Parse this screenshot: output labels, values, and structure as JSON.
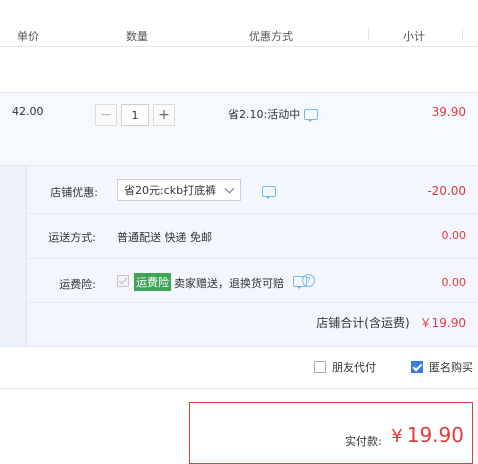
{
  "header": {
    "col_price": "单价",
    "col_qty": "数量",
    "col_promo": "优惠方式",
    "col_subtotal": "小计"
  },
  "item": {
    "price": "42.00",
    "qty": "1",
    "minus_symbol": "−",
    "plus_symbol": "+",
    "promo_text": "省2.10:活动中",
    "subtotal": "39.90"
  },
  "shop": {
    "discount_label": "店铺优惠:",
    "discount_select": "省20元:ckb打底裤",
    "discount_value": "-20.00",
    "shipping_label": "运送方式:",
    "shipping_text": "普通配送 快递 免邮",
    "shipping_value": "0.00",
    "insurance_label": "运费险:",
    "insurance_tag": "运费险",
    "insurance_text": "卖家赠送，退换货可赔",
    "insurance_value": "0.00",
    "total_label": "店铺合计(含运费)",
    "total_value": "￥19.90"
  },
  "options": {
    "friend_pay": "朋友代付",
    "anonymous": "匿名购买",
    "friend_pay_checked": false,
    "anonymous_checked": true
  },
  "payment": {
    "label": "实付款:",
    "currency": "¥",
    "amount": "19.90"
  },
  "colors": {
    "accent_red": "#e4393c",
    "panel_blue": "#f3f7fd",
    "checkbox_blue": "#3a7ce1",
    "tag_green": "#3fa457"
  }
}
